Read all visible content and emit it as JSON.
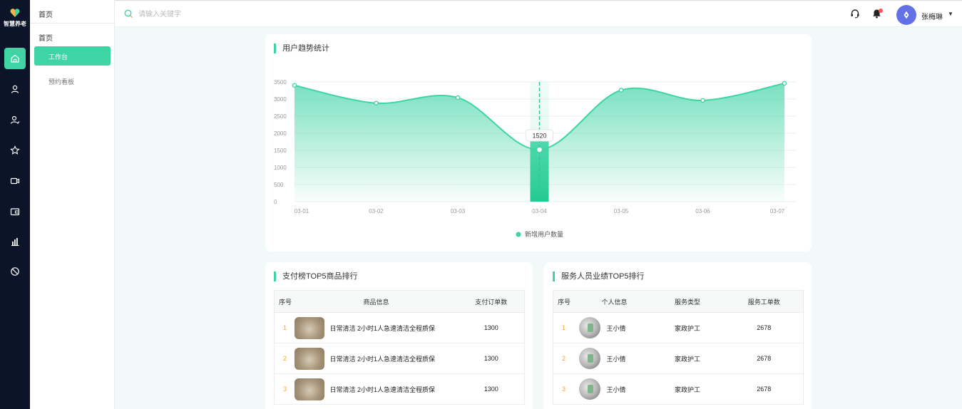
{
  "rail": {
    "logo_text": "智慧养老",
    "items": [
      {
        "icon": "home-icon",
        "active": true
      },
      {
        "icon": "user-icon"
      },
      {
        "icon": "user-check-icon"
      },
      {
        "icon": "star-icon"
      },
      {
        "icon": "video-icon"
      },
      {
        "icon": "wallet-icon"
      },
      {
        "icon": "bar-chart-icon"
      },
      {
        "icon": "block-icon"
      }
    ]
  },
  "sidebar": {
    "breadcrumb": "首页",
    "section_title": "首页",
    "items": [
      {
        "label": "工作台",
        "active": true
      },
      {
        "label": "预约看板"
      }
    ]
  },
  "topbar": {
    "search_placeholder": "请输入关键字",
    "user_name": "张梅琳"
  },
  "trend_card": {
    "title": "用户趋势统计"
  },
  "chart_data": {
    "type": "area",
    "title": "用户趋势统计",
    "x": [
      "03-01",
      "03-02",
      "03-03",
      "03-04",
      "03-05",
      "03-06",
      "03-07"
    ],
    "y_ticks": [
      "0",
      "500",
      "1000",
      "1500",
      "2000",
      "2500",
      "3000",
      "3500"
    ],
    "ylim": [
      0,
      3500
    ],
    "series": [
      {
        "name": "新增用户数量",
        "values": [
          3400,
          2880,
          3040,
          1520,
          3260,
          2960,
          3460
        ],
        "color": "#3ed4a4"
      }
    ],
    "highlight": {
      "index": 3,
      "label": "1520"
    },
    "legend": "bottom-center",
    "grid": true
  },
  "top_products": {
    "title": "支付榜TOP5商品排行",
    "columns": [
      "序号",
      "商品信息",
      "支付订单数"
    ],
    "rows": [
      {
        "rank": "1",
        "name": "日常清洁 2小时1人急速清洁全程质保",
        "orders": "1300"
      },
      {
        "rank": "2",
        "name": "日常清洁 2小时1人急速清洁全程质保",
        "orders": "1300"
      },
      {
        "rank": "3",
        "name": "日常清洁 2小时1人急速清洁全程质保",
        "orders": "1300"
      }
    ]
  },
  "top_staff": {
    "title": "服务人员业绩TOP5排行",
    "columns": [
      "序号",
      "个人信息",
      "服务类型",
      "服务工单数"
    ],
    "rows": [
      {
        "rank": "1",
        "name": "王小倩",
        "type": "家政护工",
        "count": "2678"
      },
      {
        "rank": "2",
        "name": "王小倩",
        "type": "家政护工",
        "count": "2678"
      },
      {
        "rank": "3",
        "name": "王小倩",
        "type": "家政护工",
        "count": "2678"
      }
    ]
  }
}
